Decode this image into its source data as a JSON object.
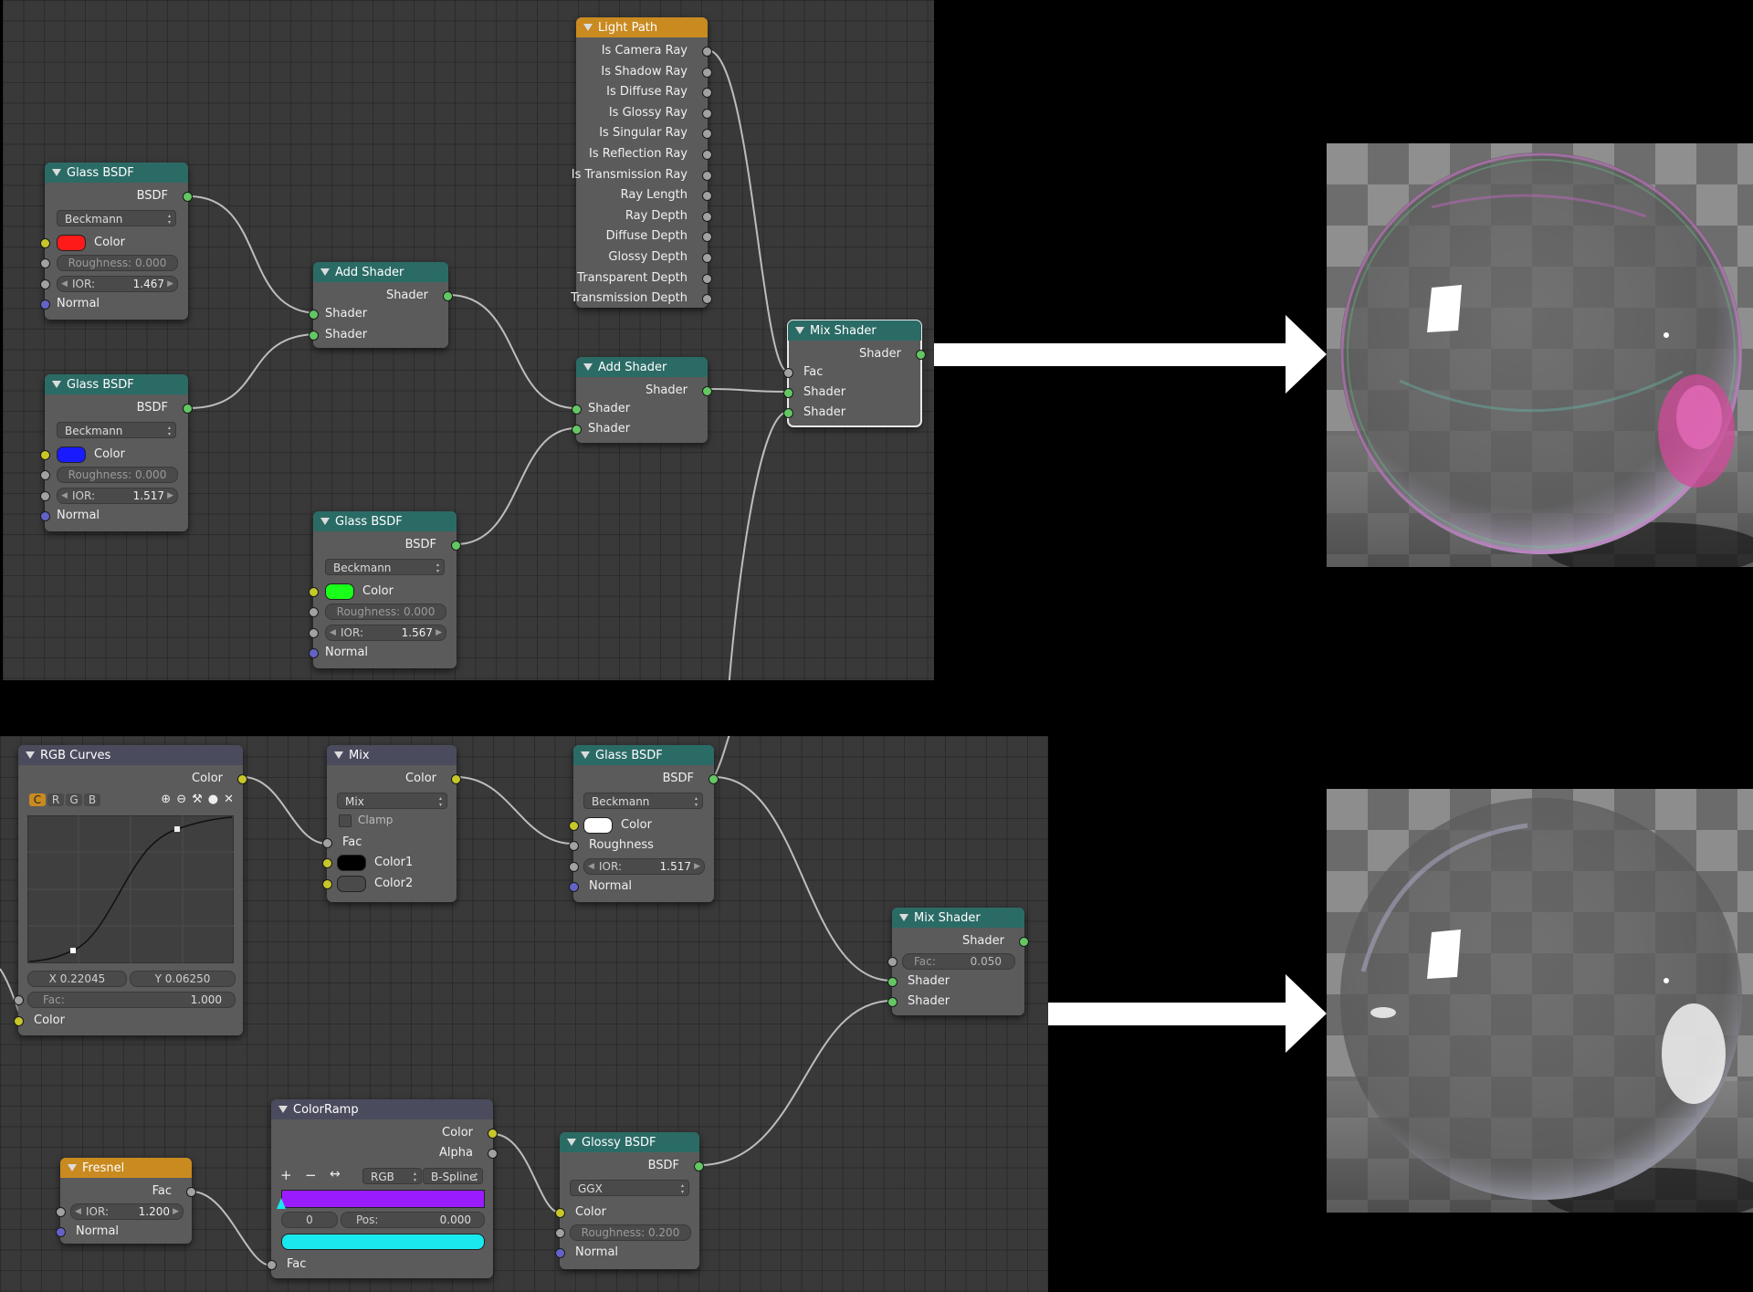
{
  "top_panel": {
    "glass1": {
      "title": "Glass BSDF",
      "output": "BSDF",
      "distribution": "Beckmann",
      "color_label": "Color",
      "color": "#ff1a1a",
      "roughness": "Roughness: 0.000",
      "ior_label": "IOR:",
      "ior": "1.467",
      "normal": "Normal"
    },
    "glass2": {
      "title": "Glass BSDF",
      "output": "BSDF",
      "distribution": "Beckmann",
      "color_label": "Color",
      "color": "#1a1aff",
      "roughness": "Roughness: 0.000",
      "ior_label": "IOR:",
      "ior": "1.517",
      "normal": "Normal"
    },
    "glass3": {
      "title": "Glass BSDF",
      "output": "BSDF",
      "distribution": "Beckmann",
      "color_label": "Color",
      "color": "#1aff1a",
      "roughness": "Roughness: 0.000",
      "ior_label": "IOR:",
      "ior": "1.567",
      "normal": "Normal"
    },
    "add1": {
      "title": "Add Shader",
      "output": "Shader",
      "in1": "Shader",
      "in2": "Shader"
    },
    "add2": {
      "title": "Add Shader",
      "output": "Shader",
      "in1": "Shader",
      "in2": "Shader"
    },
    "lightpath": {
      "title": "Light Path",
      "outputs": [
        "Is Camera Ray",
        "Is Shadow Ray",
        "Is Diffuse Ray",
        "Is Glossy Ray",
        "Is Singular Ray",
        "Is Reflection Ray",
        "Is Transmission Ray",
        "Ray Length",
        "Ray Depth",
        "Diffuse Depth",
        "Glossy Depth",
        "Transparent Depth",
        "Transmission Depth"
      ]
    },
    "mix": {
      "title": "Mix Shader",
      "output": "Shader",
      "fac": "Fac",
      "in1": "Shader",
      "in2": "Shader"
    }
  },
  "bottom_panel": {
    "curves": {
      "title": "RGB Curves",
      "output": "Color",
      "channels": [
        "C",
        "R",
        "G",
        "B"
      ],
      "x_label": "X 0.22045",
      "y_label": "Y 0.06250",
      "fac_label": "Fac:",
      "fac_value": "1.000",
      "input": "Color"
    },
    "mixrgb": {
      "title": "Mix",
      "output": "Color",
      "blend": "Mix",
      "clamp": "Clamp",
      "fac": "Fac",
      "color1": "Color1",
      "color2": "Color2",
      "color1_swatch": "#000000",
      "color2_swatch": "#4a4a4a"
    },
    "glass": {
      "title": "Glass BSDF",
      "output": "BSDF",
      "distribution": "Beckmann",
      "color_label": "Color",
      "color": "#ffffff",
      "roughness": "Roughness",
      "ior_label": "IOR:",
      "ior": "1.517",
      "normal": "Normal"
    },
    "mix": {
      "title": "Mix Shader",
      "output": "Shader",
      "fac_label": "Fac:",
      "fac_value": "0.050",
      "in1": "Shader",
      "in2": "Shader"
    },
    "colorramp": {
      "title": "ColorRamp",
      "out_color": "Color",
      "out_alpha": "Alpha",
      "mode": "RGB",
      "interp": "B-Spline",
      "stop_index": "0",
      "pos_label": "Pos:",
      "pos_value": "0.000",
      "ramp_color": "#9b1bff",
      "stop_color": "#19e8ee",
      "fac": "Fac"
    },
    "fresnel": {
      "title": "Fresnel",
      "output": "Fac",
      "ior_label": "IOR:",
      "ior": "1.200",
      "normal": "Normal"
    },
    "glossy": {
      "title": "Glossy BSDF",
      "output": "BSDF",
      "distribution": "GGX",
      "color_label": "Color",
      "roughness": "Roughness: 0.200",
      "normal": "Normal"
    }
  },
  "icons": [
    "collapse-arrow-icon",
    "zoom-in-icon",
    "zoom-out-icon",
    "wrench-icon",
    "dot-icon",
    "close-icon",
    "add-icon",
    "remove-icon",
    "flip-icon",
    "right-arrow-icon"
  ]
}
